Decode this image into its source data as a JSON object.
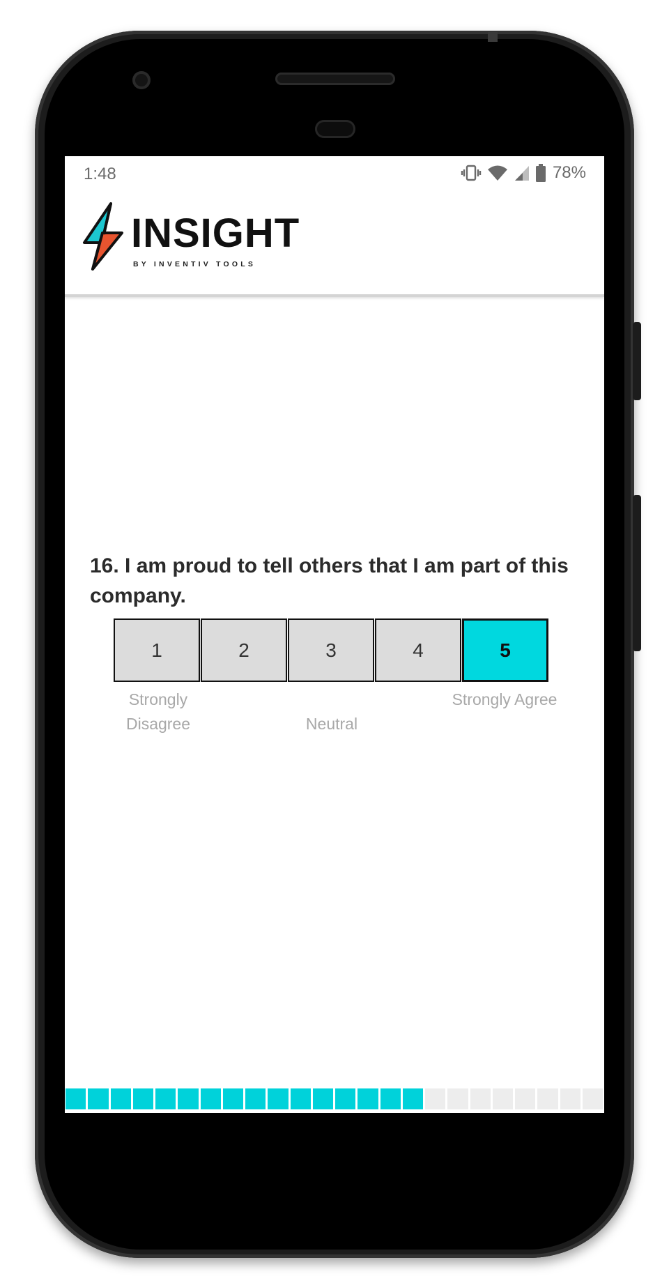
{
  "status_bar": {
    "time": "1:48",
    "battery_percent": "78%",
    "icons": [
      "vibrate-icon",
      "wifi-icon",
      "cell-signal-icon",
      "battery-icon"
    ]
  },
  "app": {
    "logo_word": "INSIGHT",
    "logo_tagline": "BY INVENTIV TOOLS",
    "brand_colors": {
      "teal": "#1cc7d0",
      "orange": "#e8542f",
      "dark": "#111111"
    }
  },
  "question": {
    "text": "16. I am proud to tell others that I am part of this company.",
    "options": [
      {
        "label": "1",
        "selected": false
      },
      {
        "label": "2",
        "selected": false
      },
      {
        "label": "3",
        "selected": false
      },
      {
        "label": "4",
        "selected": false
      },
      {
        "label": "5",
        "selected": true
      }
    ],
    "scale_labels": {
      "low": "Strongly Disagree",
      "mid": "Neutral",
      "high": "Strongly Agree"
    },
    "selected_color": "#00d8df"
  },
  "progress": {
    "completed": 16,
    "total": 24,
    "done_color": "#00d2da",
    "todo_color": "#ededed"
  }
}
